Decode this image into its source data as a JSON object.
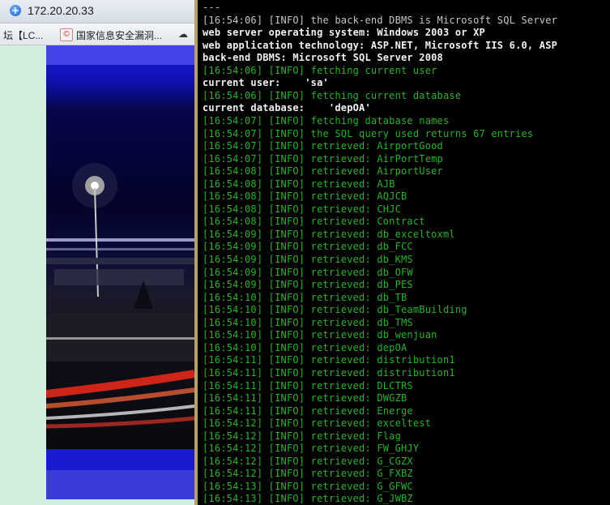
{
  "browser": {
    "address": "172.20.20.33",
    "bookmarks": [
      {
        "label": "坛【LC..."
      },
      {
        "label": "国家信息安全漏洞..."
      }
    ]
  },
  "terminal": {
    "lines": [
      {
        "text": "---",
        "style": "grey"
      },
      {
        "text": "[16:54:06] [INFO] the back-end DBMS is Microsoft SQL Server",
        "style": "grey"
      },
      {
        "text": "web server operating system: Windows 2003 or XP",
        "style": "white"
      },
      {
        "text": "web application technology: ASP.NET, Microsoft IIS 6.0, ASP",
        "style": "white"
      },
      {
        "text": "back-end DBMS: Microsoft SQL Server 2008",
        "style": "white"
      },
      {
        "text": "[16:54:06] [INFO] fetching current user",
        "style": "green"
      },
      {
        "text": "current user:    'sa'",
        "style": "white"
      },
      {
        "text": "[16:54:06] [INFO] fetching current database",
        "style": "green"
      },
      {
        "text": "current database:    'depOA'",
        "style": "white"
      },
      {
        "text": "[16:54:07] [INFO] fetching database names",
        "style": "green"
      },
      {
        "text": "[16:54:07] [INFO] the SQL query used returns 67 entries",
        "style": "green"
      },
      {
        "text": "[16:54:07] [INFO] retrieved: AirportGood",
        "style": "green"
      },
      {
        "text": "[16:54:07] [INFO] retrieved: AirPortTemp",
        "style": "green"
      },
      {
        "text": "[16:54:08] [INFO] retrieved: AirportUser",
        "style": "green"
      },
      {
        "text": "[16:54:08] [INFO] retrieved: AJB",
        "style": "green"
      },
      {
        "text": "[16:54:08] [INFO] retrieved: AQJCB",
        "style": "green"
      },
      {
        "text": "[16:54:08] [INFO] retrieved: CHJC",
        "style": "green"
      },
      {
        "text": "[16:54:08] [INFO] retrieved: Contract",
        "style": "green"
      },
      {
        "text": "[16:54:09] [INFO] retrieved: db_exceltoxml",
        "style": "green"
      },
      {
        "text": "[16:54:09] [INFO] retrieved: db_FCC",
        "style": "green"
      },
      {
        "text": "[16:54:09] [INFO] retrieved: db_KMS",
        "style": "green"
      },
      {
        "text": "[16:54:09] [INFO] retrieved: db_OFW",
        "style": "green"
      },
      {
        "text": "[16:54:09] [INFO] retrieved: db_PES",
        "style": "green"
      },
      {
        "text": "[16:54:10] [INFO] retrieved: db_TB",
        "style": "green"
      },
      {
        "text": "[16:54:10] [INFO] retrieved: db_TeamBuilding",
        "style": "green"
      },
      {
        "text": "[16:54:10] [INFO] retrieved: db_TMS",
        "style": "green"
      },
      {
        "text": "[16:54:10] [INFO] retrieved: db_wenjuan",
        "style": "green"
      },
      {
        "text": "[16:54:10] [INFO] retrieved: depOA",
        "style": "green"
      },
      {
        "text": "[16:54:11] [INFO] retrieved: distribution1",
        "style": "green"
      },
      {
        "text": "[16:54:11] [INFO] retrieved: distribution1",
        "style": "green"
      },
      {
        "text": "[16:54:11] [INFO] retrieved: DLCTRS",
        "style": "green"
      },
      {
        "text": "[16:54:11] [INFO] retrieved: DWGZB",
        "style": "green"
      },
      {
        "text": "[16:54:11] [INFO] retrieved: Energe",
        "style": "green"
      },
      {
        "text": "[16:54:12] [INFO] retrieved: exceltest",
        "style": "green"
      },
      {
        "text": "[16:54:12] [INFO] retrieved: Flag",
        "style": "green"
      },
      {
        "text": "[16:54:12] [INFO] retrieved: FW_GHJY",
        "style": "green"
      },
      {
        "text": "[16:54:12] [INFO] retrieved: G_CGZX",
        "style": "green"
      },
      {
        "text": "[16:54:12] [INFO] retrieved: G_FXBZ",
        "style": "green"
      },
      {
        "text": "[16:54:13] [INFO] retrieved: G_GFWC",
        "style": "green"
      },
      {
        "text": "[16:54:13] [INFO] retrieved: G_JWBZ",
        "style": "green"
      }
    ]
  }
}
